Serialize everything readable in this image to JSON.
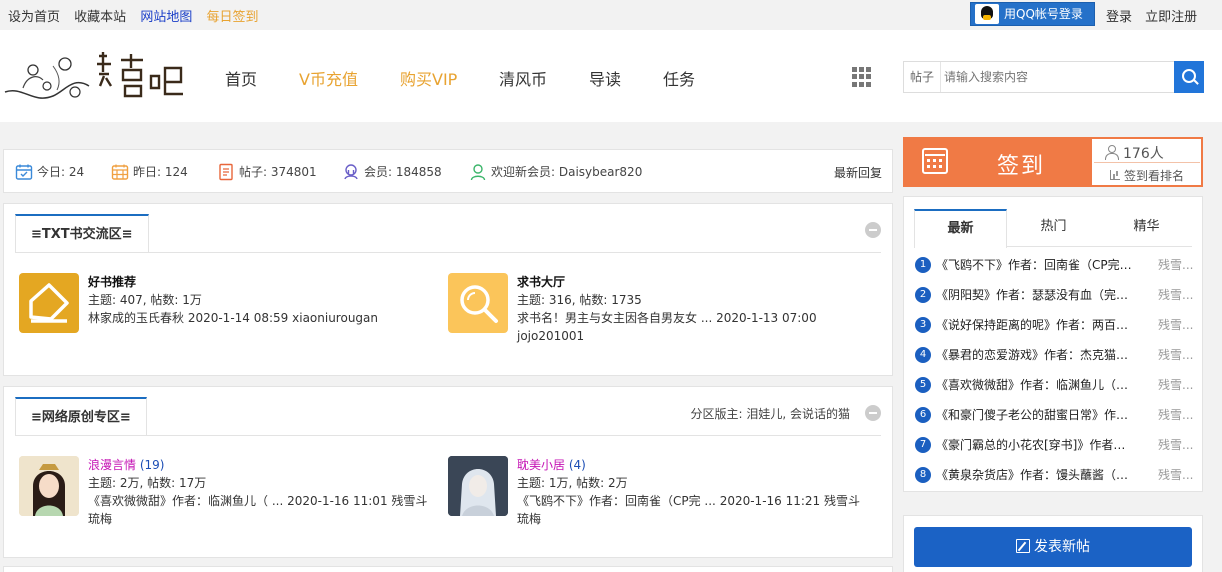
{
  "topbar": {
    "set_home": "设为首页",
    "bookmark": "收藏本站",
    "sitemap": "网站地图",
    "daily_checkin": "每日签到",
    "qq_login": "用QQ帐号登录",
    "login": "登录",
    "register": "立即注册"
  },
  "header": {
    "nav": [
      "首页",
      "V币充值",
      "购买VIP",
      "清风币",
      "导读",
      "任务"
    ],
    "search_type": "帖子",
    "search_placeholder": "请输入搜索内容"
  },
  "stats": {
    "today": "今日: 24",
    "yesterday": "昨日: 124",
    "posts": "帖子: 374801",
    "members": "会员: 184858",
    "welcome": "欢迎新会员: Daisybear820",
    "latest_replies": "最新回复"
  },
  "sections": [
    {
      "title": "≡TXT书交流区≡",
      "moderators": "",
      "forums": [
        {
          "name": "好书推荐",
          "count": "",
          "stats": "主题: 407, 帖数: 1万",
          "last": "林家成的玉氏春秋 2020-1-14 08:59 xiaoniurougan"
        },
        {
          "name": "求书大厅",
          "count": "",
          "stats": "主题: 316, 帖数: 1735",
          "last": "求书名！男主与女主因各自男友女 ... 2020-1-13 07:00 jojo201001"
        }
      ]
    },
    {
      "title": "≡网络原创专区≡",
      "moderators": "分区版主: 泪娃儿, 会说话的猫",
      "forums": [
        {
          "name": "浪漫言情",
          "count": "(19)",
          "stats": "主题: 2万, 帖数: 17万",
          "last": "《喜欢微微甜》作者：临渊鱼儿（ ... 2020-1-16 11:01 残雪斗琉梅"
        },
        {
          "name": "耽美小居",
          "count": "(4)",
          "stats": "主题: 1万, 帖数: 2万",
          "last": "《飞鸥不下》作者：回南雀（CP完 ... 2020-1-16 11:21 残雪斗琉梅"
        }
      ]
    }
  ],
  "checkin": {
    "label": "签到",
    "people": "176人",
    "ranking": "签到看排名"
  },
  "hot": {
    "tabs": [
      "最新",
      "热门",
      "精华"
    ],
    "items": [
      {
        "n": "1",
        "title": "《飞鸥不下》作者：回南雀（CP完结...",
        "author": "残雪..."
      },
      {
        "n": "2",
        "title": "《阴阳契》作者：瑟瑟没有血（完结...",
        "author": "残雪..."
      },
      {
        "n": "3",
        "title": "《说好保持距离的呢》作者：两百斤...",
        "author": "残雪..."
      },
      {
        "n": "4",
        "title": "《暴君的恋爱游戏》作者：杰克猫咪...",
        "author": "残雪..."
      },
      {
        "n": "5",
        "title": "《喜欢微微甜》作者：临渊鱼儿（完...",
        "author": "残雪..."
      },
      {
        "n": "6",
        "title": "《和豪门傻子老公的甜蜜日常》作者...",
        "author": "残雪..."
      },
      {
        "n": "7",
        "title": "《豪门霸总的小花农[穿书]》作者：牛...",
        "author": "残雪..."
      },
      {
        "n": "8",
        "title": "《黄泉杂货店》作者：馒头蘸酱（完...",
        "author": "残雪..."
      }
    ]
  },
  "post_button": "发表新帖",
  "colors": {
    "accent_blue": "#1b62c5",
    "checkin_orange": "#f07a45",
    "nav_gold": "#e8a331",
    "forum_pink": "#c515b5"
  }
}
